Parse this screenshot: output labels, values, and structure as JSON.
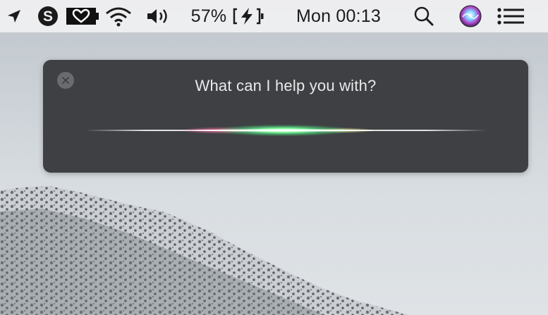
{
  "menubar": {
    "battery_percent": "57%",
    "clock": "Mon 00:13",
    "icons": [
      "location-arrow-icon",
      "skype-icon",
      "heart-battery-icon",
      "wifi-icon",
      "volume-icon",
      "battery-charging-icon",
      "spotlight-search-icon",
      "siri-icon",
      "notification-center-icon"
    ]
  },
  "siri": {
    "prompt": "What can I help you with?",
    "state": "listening"
  },
  "colors": {
    "panel": "#3f4044",
    "menubar": "#eeeef0",
    "wave_green": "#3fe07a",
    "wave_pink": "#f05a8c"
  }
}
